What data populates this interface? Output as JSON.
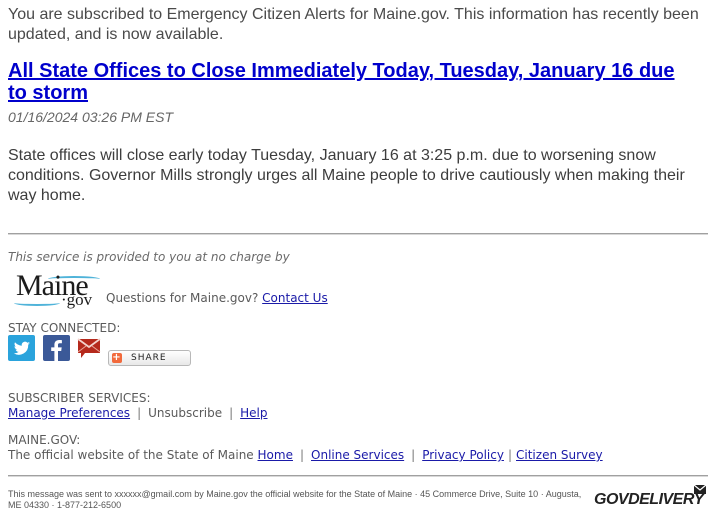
{
  "intro": "You are subscribed to Emergency Citizen Alerts for Maine.gov. This information has recently been updated, and is now available.",
  "headline": "All State Offices to Close Immediately Today, Tuesday, January 16 due to storm",
  "timestamp": "01/16/2024 03:26 PM EST",
  "body": "State offices will close early today Tuesday, January 16 at 3:25 p.m. due to worsening snow conditions. Governor Mills strongly urges all Maine people to drive cautiously when making their way home.",
  "footer": {
    "provided_by": "This service is provided to you at no charge by",
    "logo": {
      "word": "Maine",
      "suffix": "·gov"
    },
    "questions": "Questions for Maine.gov?",
    "contact_us": "Contact Us",
    "stay_connected": "STAY CONNECTED:",
    "social": [
      {
        "name": "twitter",
        "icon": "twitter-icon",
        "color": "#2aa3dc"
      },
      {
        "name": "facebook",
        "icon": "facebook-icon",
        "color": "#3b5998"
      },
      {
        "name": "email",
        "icon": "email-icon",
        "color": "#b5291c"
      }
    ],
    "share_label": "SHARE",
    "subscriber_services": {
      "heading": "SUBSCRIBER SERVICES:",
      "manage": "Manage Preferences",
      "unsubscribe": "Unsubscribe",
      "help": "Help",
      "separator": "|"
    },
    "maine_gov": {
      "heading": "MAINE.GOV:",
      "description": "The official website of the State of Maine",
      "links": [
        "Home",
        "Online Services",
        "Privacy Policy",
        "Citizen Survey"
      ],
      "separator": "|"
    },
    "fine_print": "This message was sent to xxxxxx@gmail.com by Maine.gov the official website for the State of Maine · 45 Commerce Drive, Suite 10 · Augusta, ME 04330 · 1-877-212-6500",
    "brand": "GOVDELIVERY"
  },
  "colors": {
    "link": "#1a1aa8",
    "headline": "#0000cc",
    "text": "#555555"
  }
}
